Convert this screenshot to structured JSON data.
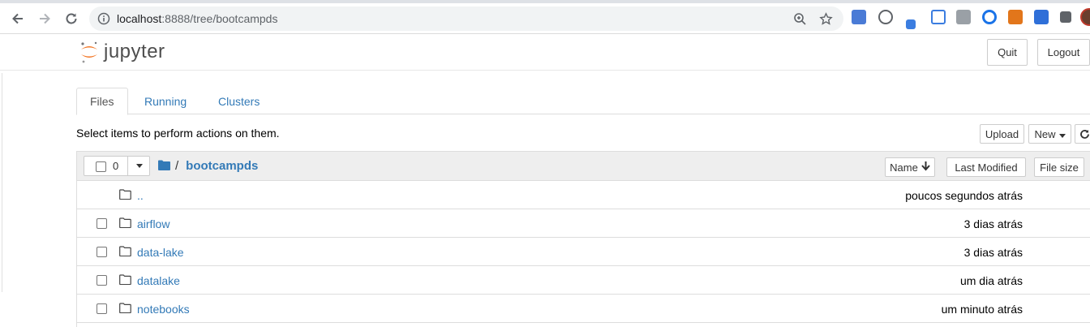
{
  "browser": {
    "url_host": "localhost",
    "url_rest": ":8888/tree/bootcampds"
  },
  "header": {
    "logo_text": "jupyter",
    "quit_label": "Quit",
    "logout_label": "Logout"
  },
  "tabs": [
    {
      "label": "Files",
      "active": true
    },
    {
      "label": "Running",
      "active": false
    },
    {
      "label": "Clusters",
      "active": false
    }
  ],
  "toolbar": {
    "instructions": "Select items to perform actions on them.",
    "upload_label": "Upload",
    "new_label": "New"
  },
  "list_header": {
    "selected_count": "0",
    "breadcrumb_separator": "/",
    "current_folder": "bootcampds",
    "sort_name_label": "Name",
    "sort_modified_label": "Last Modified",
    "sort_size_label": "File size"
  },
  "items": [
    {
      "name": "..",
      "modified": "poucos segundos atrás",
      "has_checkbox": false
    },
    {
      "name": "airflow",
      "modified": "3 dias atrás",
      "has_checkbox": true
    },
    {
      "name": "data-lake",
      "modified": "3 dias atrás",
      "has_checkbox": true
    },
    {
      "name": "datalake",
      "modified": "um dia atrás",
      "has_checkbox": true
    },
    {
      "name": "notebooks",
      "modified": "um minuto atrás",
      "has_checkbox": true
    }
  ],
  "colors": {
    "link": "#337ab7",
    "jupyter_orange": "#f37726"
  }
}
